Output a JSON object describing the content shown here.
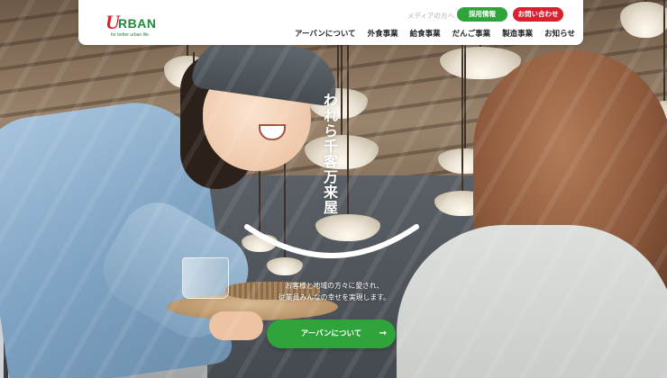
{
  "brand": {
    "logo_mark": "U",
    "logo_word": "RBAN",
    "tagline": "for better urban life"
  },
  "header": {
    "media_link": "メディアの方へ",
    "recruit_label": "採用情報",
    "contact_label": "お問い合わせ",
    "nav": [
      {
        "label": "アーバンについて"
      },
      {
        "label": "外食事業"
      },
      {
        "label": "給食事業"
      },
      {
        "label": "だんご事業"
      },
      {
        "label": "製造事業"
      },
      {
        "label": "お知らせ"
      }
    ]
  },
  "hero": {
    "catch_copy": "われら千客万来屋",
    "sub_line1": "お客様と地域の方々に愛され、",
    "sub_line2": "従業員みんなの幸せを実現します。",
    "cta_label": "アーバンについて",
    "cta_icon": "arrow-right-icon"
  },
  "colors": {
    "brand_red": "#d9202e",
    "brand_green": "#2ea43b"
  }
}
